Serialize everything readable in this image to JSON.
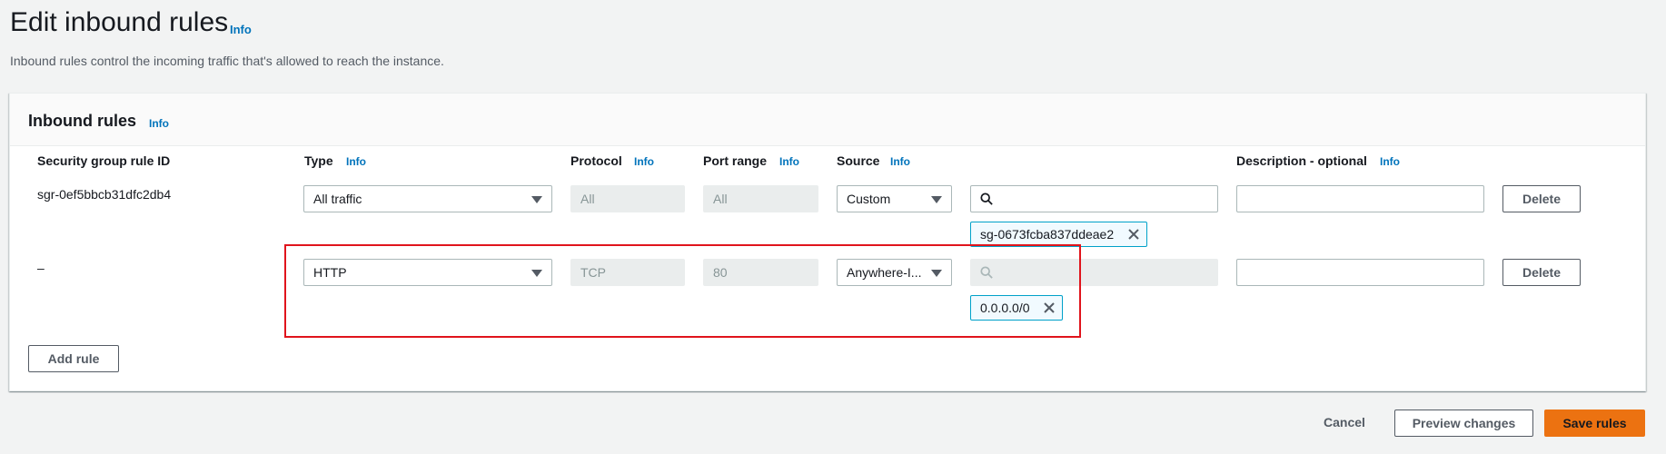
{
  "page": {
    "title": "Edit inbound rules",
    "info": "Info",
    "description": "Inbound rules control the incoming traffic that's allowed to reach the instance."
  },
  "panel": {
    "title": "Inbound rules",
    "info": "Info",
    "columns": {
      "rule_id": "Security group rule ID",
      "type": "Type",
      "protocol": "Protocol",
      "port_range": "Port range",
      "source": "Source",
      "description": "Description - optional",
      "info": "Info"
    },
    "rules": [
      {
        "rule_id": "sgr-0ef5bbcb31dfc2db4",
        "type": "All traffic",
        "protocol": "All",
        "port_range": "All",
        "source": "Custom",
        "source_search_value": "",
        "source_token": "sg-0673fcba837ddeae2",
        "description": "",
        "delete_label": "Delete"
      },
      {
        "rule_id": "–",
        "type": "HTTP",
        "protocol": "TCP",
        "port_range": "80",
        "source": "Anywhere-I...",
        "source_search_value": "",
        "source_token": "0.0.0.0/0",
        "description": "",
        "delete_label": "Delete"
      }
    ],
    "add_rule_label": "Add rule"
  },
  "footer": {
    "cancel_label": "Cancel",
    "preview_label": "Preview changes",
    "save_label": "Save rules"
  },
  "colors": {
    "primary_button": "#ec7211",
    "link": "#0073bb",
    "token_border": "#00a1c9",
    "highlight": "#e0141c"
  },
  "icons": [
    "search-icon",
    "close-icon",
    "chevron-down-icon"
  ]
}
